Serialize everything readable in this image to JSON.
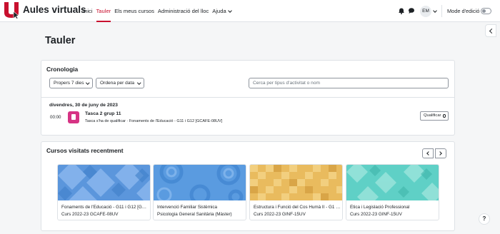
{
  "navbar": {
    "brand": "Aules virtuals",
    "links": [
      "Inici",
      "Tauler",
      "Els meus cursos",
      "Administració del lloc"
    ],
    "help_label": "Ajuda",
    "avatar_initials": "EM",
    "edit_mode_label": "Mode d'edició",
    "accent_color": "#c8102e"
  },
  "page": {
    "title": "Tauler"
  },
  "timeline": {
    "title": "Cronologia",
    "filter_days": "Propers 7 dies",
    "sort_label": "Ordena per data",
    "search_placeholder": "Cerca per tipus d'activitat o nom",
    "date": "divendres, 30 de juny de 2023",
    "event": {
      "time": "00:00",
      "title": "Tasca 2 grup 11",
      "description": "Tasca s'ha de qualificar · Fonaments de l'Educació - G11 i G12 [GCAFE-08UV]",
      "action": "Qualificar",
      "icon": "assignment-icon",
      "icon_color": "#d63384"
    }
  },
  "recent": {
    "title": "Cursos visitats recentment",
    "courses": [
      {
        "name": "Fonaments de l'Educació - G11 i G12 [GCAFE-08UV]",
        "category": "Curs 2022-23 GCAFE-08UV",
        "color": "#4f8fd6"
      },
      {
        "name": "Intervenció Familiar Sistèmica",
        "category": "Psicologia General Sanitària (Màster)",
        "color": "#5a9be0"
      },
      {
        "name": "Estructura i Funció del Cos Humà II - G1 [GINF-15UV]",
        "category": "Curs 2022-23 GINF-15UV",
        "color": "#e7b85a"
      },
      {
        "name": "Ètica i Legislació Professional",
        "category": "Curs 2022-23 GINF-15UV",
        "color": "#57cfc3"
      }
    ]
  },
  "help_button": "?"
}
